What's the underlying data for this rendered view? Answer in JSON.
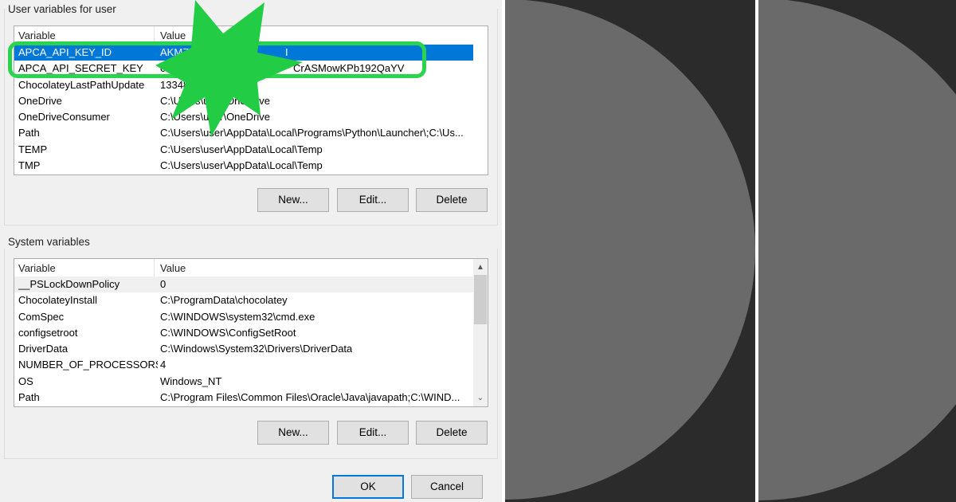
{
  "user_group": {
    "title": "User variables for user",
    "columns": [
      "Variable",
      "Value"
    ],
    "rows": [
      {
        "variable": "APCA_API_KEY_ID",
        "value": "AKMZ4",
        "value_tail": "I",
        "selected": true
      },
      {
        "variable": "APCA_API_SECRET_KEY",
        "value": "01JoH7",
        "value_tail": "CrASMowKPb192QaYV",
        "selected": false
      },
      {
        "variable": "ChocolateyLastPathUpdate",
        "value": "13348",
        "selected": false
      },
      {
        "variable": "OneDrive",
        "value": "C:\\Users\\user\\OneDrive",
        "selected": false
      },
      {
        "variable": "OneDriveConsumer",
        "value": "C:\\Users\\user\\OneDrive",
        "selected": false
      },
      {
        "variable": "Path",
        "value": "C:\\Users\\user\\AppData\\Local\\Programs\\Python\\Launcher\\;C:\\Us...",
        "selected": false
      },
      {
        "variable": "TEMP",
        "value": "C:\\Users\\user\\AppData\\Local\\Temp",
        "selected": false
      },
      {
        "variable": "TMP",
        "value": "C:\\Users\\user\\AppData\\Local\\Temp",
        "selected": false
      }
    ],
    "buttons": {
      "new": "New...",
      "edit": "Edit...",
      "delete": "Delete"
    }
  },
  "system_group": {
    "title": "System variables",
    "columns": [
      "Variable",
      "Value"
    ],
    "rows": [
      {
        "variable": "__PSLockDownPolicy",
        "value": "0",
        "highlighted": true
      },
      {
        "variable": "ChocolateyInstall",
        "value": "C:\\ProgramData\\chocolatey"
      },
      {
        "variable": "ComSpec",
        "value": "C:\\WINDOWS\\system32\\cmd.exe"
      },
      {
        "variable": "configsetroot",
        "value": "C:\\WINDOWS\\ConfigSetRoot"
      },
      {
        "variable": "DriverData",
        "value": "C:\\Windows\\System32\\Drivers\\DriverData"
      },
      {
        "variable": "NUMBER_OF_PROCESSORS",
        "value": "4"
      },
      {
        "variable": "OS",
        "value": "Windows_NT"
      },
      {
        "variable": "Path",
        "value": "C:\\Program Files\\Common Files\\Oracle\\Java\\javapath;C:\\WIND..."
      }
    ],
    "buttons": {
      "new": "New...",
      "edit": "Edit...",
      "delete": "Delete"
    }
  },
  "dialog_buttons": {
    "ok": "OK",
    "cancel": "Cancel"
  },
  "icons": {
    "scroll_up": "chevron-up-icon",
    "scroll_down": "chevron-down-icon"
  },
  "colors": {
    "selection": "#0078d7",
    "highlight_outline": "#2ad44c",
    "redaction_star": "#22cc44",
    "panel_bg": "#2b2b2b",
    "circle": "#6a6a6a"
  }
}
